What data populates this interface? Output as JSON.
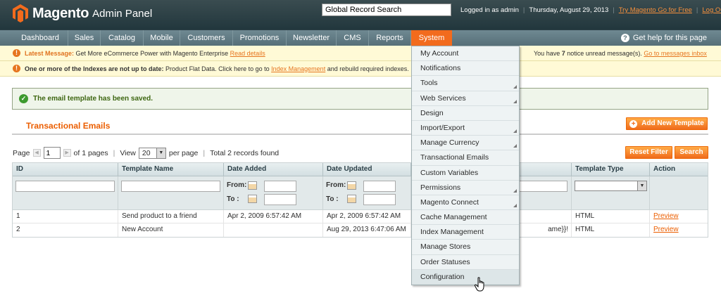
{
  "header": {
    "logo_text": "Magento",
    "logo_sub": "Admin Panel",
    "search_value": "Global Record Search",
    "logged_in": "Logged in as admin",
    "date": "Thursday, August 29, 2013",
    "try_link": "Try Magento Go for Free",
    "logout": "Log Out"
  },
  "nav": {
    "items": [
      "Dashboard",
      "Sales",
      "Catalog",
      "Mobile",
      "Customers",
      "Promotions",
      "Newsletter",
      "CMS",
      "Reports",
      "System"
    ],
    "help": "Get help for this page"
  },
  "notices": {
    "latest_label": "Latest Message:",
    "latest_text": "Get More eCommerce Power with Magento Enterprise",
    "latest_link": "Read details",
    "right_prefix": "You have",
    "right_count": "7",
    "right_text": "notice unread message(s).",
    "right_link": "Go to messages inbox",
    "index_bold": "One or more of the Indexes are not up to date:",
    "index_text": "Product Flat Data. Click here to go to",
    "index_link": "Index Management",
    "index_tail": "and rebuild required indexes."
  },
  "success": "The email template has been saved.",
  "page": {
    "title": "Transactional Emails",
    "add_button": "Add New Template",
    "reset_button": "Reset Filter",
    "search_button": "Search"
  },
  "pager": {
    "page_label": "Page",
    "page_value": "1",
    "of_pages": "of 1 pages",
    "view_label": "View",
    "per_page_value": "20",
    "per_page_label": "per page",
    "total": "Total 2 records found"
  },
  "grid": {
    "columns": [
      "ID",
      "Template Name",
      "Date Added",
      "Date Updated",
      "",
      "Template Type",
      "Action"
    ],
    "from_label": "From:",
    "to_label": "To :",
    "rows": [
      {
        "id": "1",
        "name": "Send product to a friend",
        "added": "Apr 2, 2009 6:57:42 AM",
        "updated": "Apr 2, 2009 6:57:42 AM",
        "subject": "",
        "type": "HTML",
        "action": "Preview"
      },
      {
        "id": "2",
        "name": "New Account",
        "added": "",
        "updated": "Aug 29, 2013 6:47:06 AM",
        "subject": "ame}}!",
        "type": "HTML",
        "action": "Preview"
      }
    ]
  },
  "system_menu": {
    "items": [
      {
        "label": "My Account",
        "sub": false
      },
      {
        "label": "Notifications",
        "sub": false
      },
      {
        "label": "Tools",
        "sub": true
      },
      {
        "label": "Web Services",
        "sub": true
      },
      {
        "label": "Design",
        "sub": false
      },
      {
        "label": "Import/Export",
        "sub": true
      },
      {
        "label": "Manage Currency",
        "sub": true
      },
      {
        "label": "Transactional Emails",
        "sub": false
      },
      {
        "label": "Custom Variables",
        "sub": false
      },
      {
        "label": "Permissions",
        "sub": true
      },
      {
        "label": "Magento Connect",
        "sub": true
      },
      {
        "label": "Cache Management",
        "sub": false
      },
      {
        "label": "Index Management",
        "sub": false
      },
      {
        "label": "Manage Stores",
        "sub": false
      },
      {
        "label": "Order Statuses",
        "sub": false
      },
      {
        "label": "Configuration",
        "sub": false
      }
    ]
  }
}
